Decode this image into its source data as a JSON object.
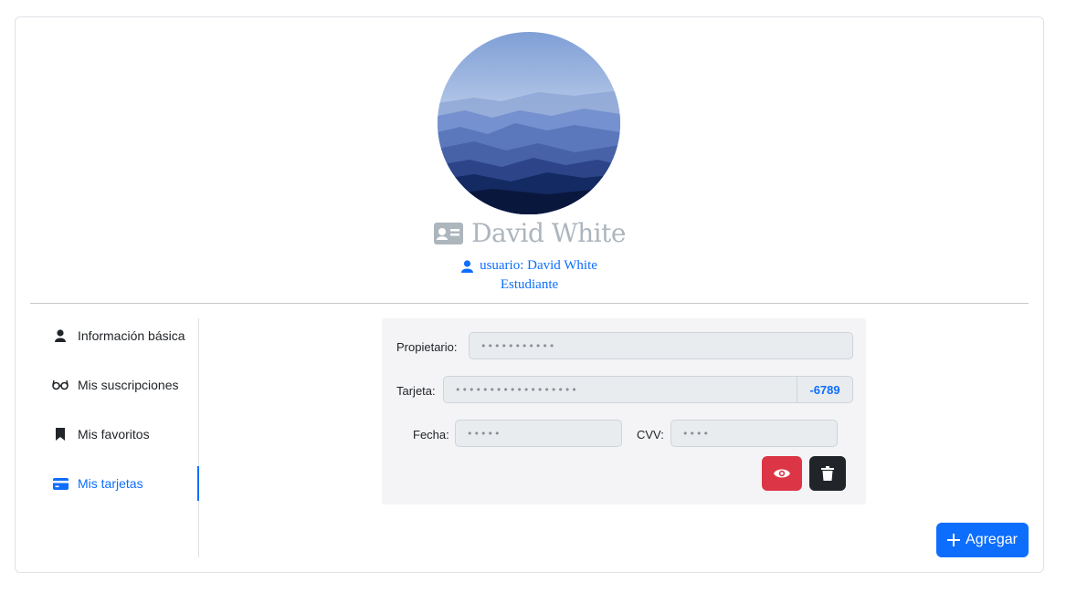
{
  "profile": {
    "name": "David White",
    "username_line": "usuario: David White",
    "role": "Estudiante"
  },
  "sidebar": {
    "items": [
      {
        "label": "Información básica",
        "icon": "user-icon",
        "active": false
      },
      {
        "label": "Mis suscripciones",
        "icon": "glasses-icon",
        "active": false
      },
      {
        "label": "Mis favoritos",
        "icon": "bookmark-icon",
        "active": false
      },
      {
        "label": "Mis tarjetas",
        "icon": "credit-card-icon",
        "active": true
      }
    ]
  },
  "card_form": {
    "owner_label": "Propietario:",
    "owner_value": "•••••••••••",
    "card_label": "Tarjeta:",
    "card_value": "••••••••••••••••••",
    "card_suffix": "-6789",
    "date_label": "Fecha:",
    "date_value": "•••••",
    "cvv_label": "CVV:",
    "cvv_value": "••••",
    "show_button_icon": "eye-icon",
    "delete_button_icon": "trash-icon"
  },
  "actions": {
    "add_label": "Agregar"
  },
  "colors": {
    "primary": "#0d6efd",
    "danger": "#dc3545",
    "dark": "#212529",
    "muted": "#adb5bd"
  }
}
